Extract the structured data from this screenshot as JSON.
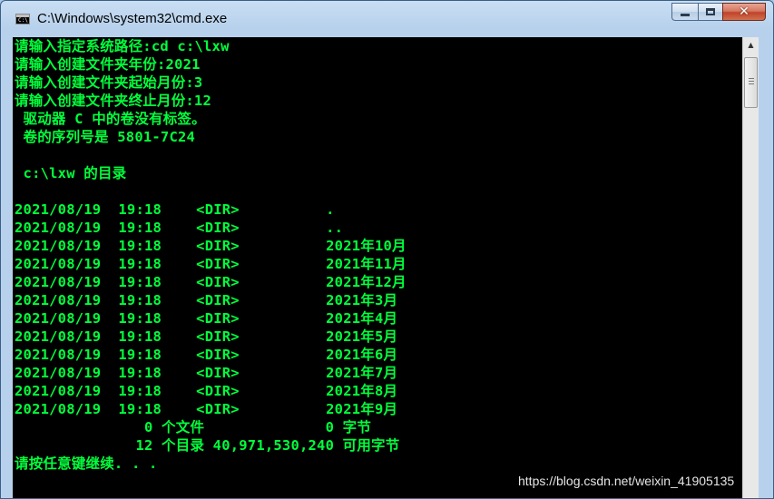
{
  "window": {
    "title": "C:\\Windows\\system32\\cmd.exe",
    "icon_label": "C:\\",
    "minimize_icon": "minimize-icon",
    "maximize_icon": "maximize-icon",
    "close_symbol": "✕"
  },
  "console": {
    "text_color": "#00ff3c",
    "background": "#000000",
    "lines": [
      "请输入指定系统路径:cd c:\\lxw",
      "请输入创建文件夹年份:2021",
      "请输入创建文件夹起始月份:3",
      "请输入创建文件夹终止月份:12",
      " 驱动器 C 中的卷没有标签。",
      " 卷的序列号是 5801-7C24",
      "",
      " c:\\lxw 的目录",
      "",
      "2021/08/19  19:18    <DIR>          .",
      "2021/08/19  19:18    <DIR>          ..",
      "2021/08/19  19:18    <DIR>          2021年10月",
      "2021/08/19  19:18    <DIR>          2021年11月",
      "2021/08/19  19:18    <DIR>          2021年12月",
      "2021/08/19  19:18    <DIR>          2021年3月",
      "2021/08/19  19:18    <DIR>          2021年4月",
      "2021/08/19  19:18    <DIR>          2021年5月",
      "2021/08/19  19:18    <DIR>          2021年6月",
      "2021/08/19  19:18    <DIR>          2021年7月",
      "2021/08/19  19:18    <DIR>          2021年8月",
      "2021/08/19  19:18    <DIR>          2021年9月",
      "               0 个文件              0 字节",
      "              12 个目录 40,971,530,240 可用字节",
      "请按任意键继续. . ."
    ]
  },
  "watermark": "https://blog.csdn.net/weixin_41905135"
}
